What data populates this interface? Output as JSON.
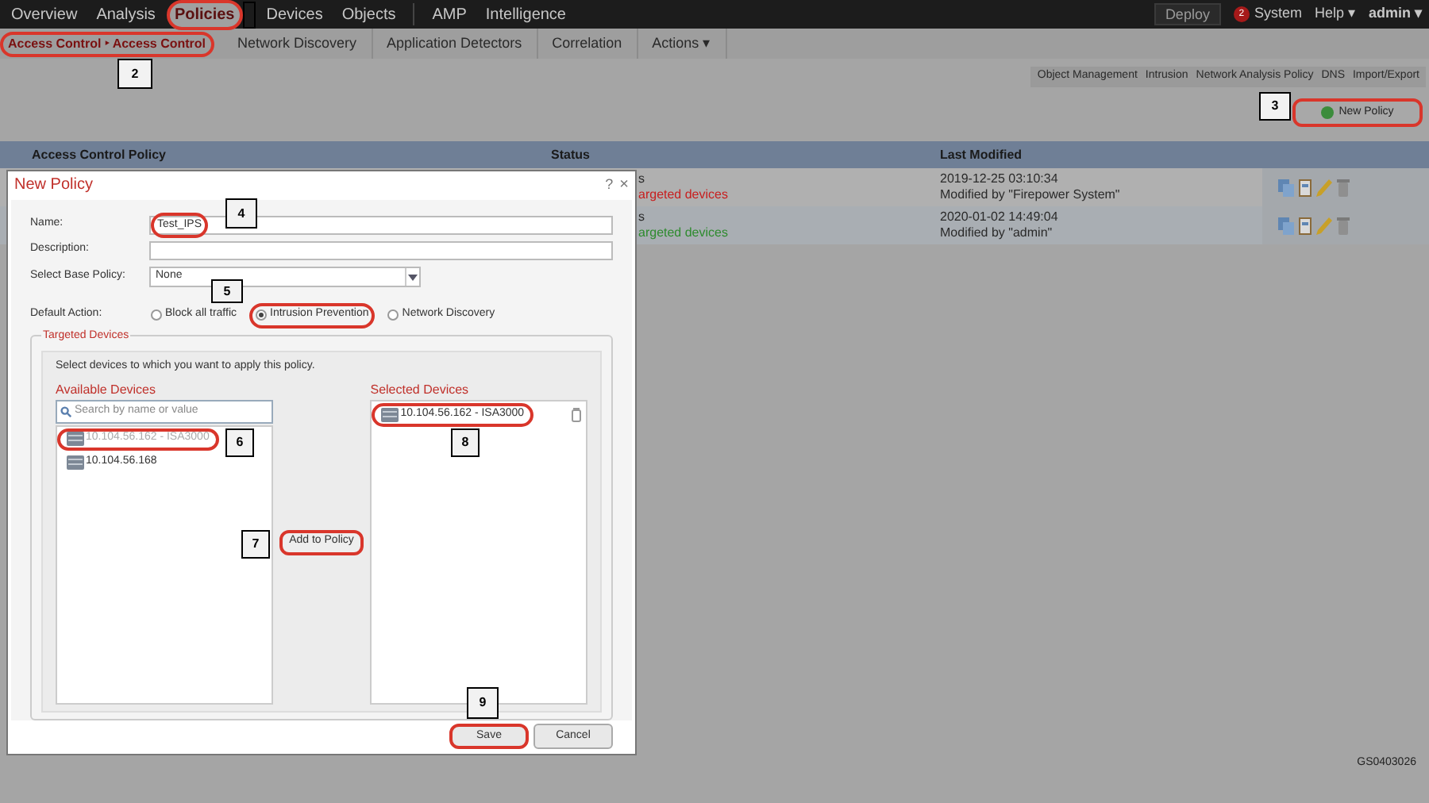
{
  "top_nav": {
    "primary_items": [
      {
        "label": "Overview",
        "selected": false,
        "highlighted": false
      },
      {
        "label": "Analysis",
        "selected": false,
        "highlighted": false
      },
      {
        "label": "Policies",
        "selected": true,
        "highlighted": true
      },
      {
        "label": "Devices",
        "selected": false,
        "highlighted": false
      },
      {
        "label": "Objects",
        "selected": false,
        "highlighted": false
      }
    ],
    "secondary_items": [
      {
        "label": "AMP",
        "selected": false,
        "highlighted": false
      },
      {
        "label": "Intelligence",
        "selected": false,
        "highlighted": false
      }
    ],
    "deploy": "Deploy",
    "alert_count": "2",
    "system": "System",
    "help": "Help ▾",
    "user": "admin ▾"
  },
  "sub_nav": {
    "breadcrumb": {
      "label": "Access Control ‣ Access Control",
      "highlighted": true
    },
    "items": [
      "Network Discovery",
      "Application Detectors",
      "Correlation",
      "Actions ▾"
    ]
  },
  "tool_links": [
    "Object Management",
    "Intrusion",
    "Network Analysis Policy",
    "DNS",
    "Import/Export"
  ],
  "new_policy_button": {
    "label": "New Policy",
    "highlighted": true
  },
  "table": {
    "columns": [
      "Access Control Policy",
      "Status",
      "Last Modified"
    ],
    "rows": [
      {
        "status_line_1": "s",
        "status_line_2": "argeted devices",
        "color": "#c81e1e",
        "modified": "2019-12-25 03:10:34",
        "modified_by": "Modified by \"Firepower System\""
      },
      {
        "status_line_1": "s",
        "status_line_2": "argeted devices",
        "color": "#2e8b2e",
        "modified": "2020-01-02 14:49:04",
        "modified_by": "Modified by \"admin\""
      }
    ]
  },
  "dialog": {
    "title": "New Policy",
    "help": "?",
    "close": "×",
    "name": {
      "label": "Name:",
      "value": "Test_IPS",
      "highlighted": true
    },
    "description": {
      "label": "Description:"
    },
    "base_policy": {
      "label": "Select Base Policy:",
      "value": "None"
    },
    "default_action": {
      "label": "Default Action:",
      "options": [
        {
          "label": "Block all traffic",
          "selected": false,
          "highlighted": false
        },
        {
          "label": "Intrusion Prevention",
          "selected": true,
          "highlighted": true
        },
        {
          "label": "Network Discovery",
          "selected": false,
          "highlighted": false
        }
      ]
    },
    "targeted_devices": {
      "legend": "Targeted Devices",
      "instruction": "Select devices to which you want to apply this policy.",
      "available_title": "Available Devices",
      "search": {
        "placeholder": "Search by name or value"
      },
      "available": [
        {
          "label": "10.104.56.162 - ISA3000",
          "disabled": true,
          "highlighted": true
        },
        {
          "label": "10.104.56.168",
          "disabled": false,
          "highlighted": false
        }
      ],
      "add_button": {
        "label": "Add to Policy",
        "highlighted": true
      },
      "selected_title": "Selected Devices",
      "selected": [
        {
          "label": "10.104.56.162 - ISA3000",
          "highlighted": true
        }
      ]
    },
    "save": {
      "label": "Save",
      "highlighted": true
    },
    "cancel": {
      "label": "Cancel",
      "highlighted": false
    }
  },
  "callouts": [
    {
      "label": "2"
    },
    {
      "label": "3"
    },
    {
      "label": "4"
    },
    {
      "label": "5"
    },
    {
      "label": "6"
    },
    {
      "label": "7"
    },
    {
      "label": "8"
    },
    {
      "label": "9"
    }
  ],
  "figure_id": "GS0403026"
}
